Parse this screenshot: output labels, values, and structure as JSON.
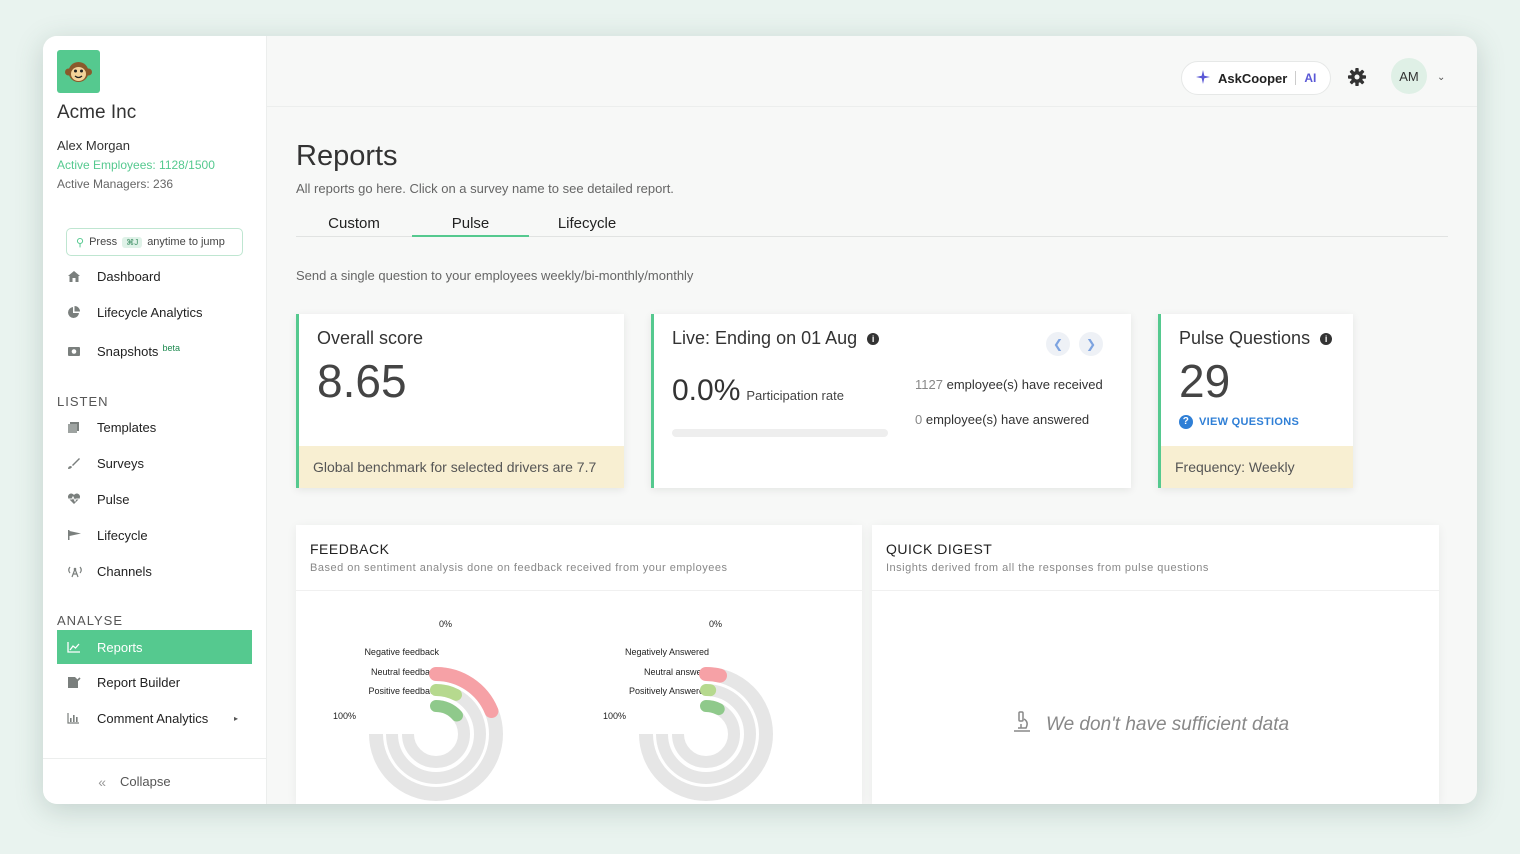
{
  "sidebar": {
    "company": "Acme Inc",
    "user_name": "Alex Morgan",
    "active_employees": "Active Employees: 1128/1500",
    "active_managers": "Active Managers: 236",
    "jump": {
      "press": "Press",
      "shortcut": "⌘J",
      "suffix": "anytime to jump"
    },
    "items_top": [
      {
        "label": "Dashboard",
        "icon": "home-icon"
      },
      {
        "label": "Lifecycle Analytics",
        "icon": "pie-icon"
      },
      {
        "label": "Snapshots",
        "badge": "beta",
        "icon": "camera-icon"
      }
    ],
    "listen_label": "LISTEN",
    "listen_items": [
      {
        "label": "Templates",
        "icon": "templates-icon"
      },
      {
        "label": "Surveys",
        "icon": "brush-icon"
      },
      {
        "label": "Pulse",
        "icon": "heartbeat-icon"
      },
      {
        "label": "Lifecycle",
        "icon": "flag-icon"
      },
      {
        "label": "Channels",
        "icon": "broadcast-icon"
      }
    ],
    "analyse_label": "ANALYSE",
    "analyse_items": [
      {
        "label": "Reports",
        "icon": "chart-icon",
        "active": true
      },
      {
        "label": "Report Builder",
        "icon": "report-builder-icon"
      },
      {
        "label": "Comment Analytics",
        "icon": "bar-chart-icon"
      }
    ],
    "collapse": "Collapse"
  },
  "topbar": {
    "ask": "AskCooper",
    "ai": "AI",
    "avatar": "AM"
  },
  "main": {
    "title": "Reports",
    "subtitle": "All reports go here. Click on a survey name to see detailed report.",
    "tabs": [
      "Custom",
      "Pulse",
      "Lifecycle"
    ],
    "active_tab": "Pulse",
    "pulse_desc": "Send a single question to your employees weekly/bi-monthly/monthly"
  },
  "cards": {
    "overall": {
      "title": "Overall score",
      "value": "8.65",
      "footer": "Global benchmark for selected drivers are 7.7"
    },
    "live": {
      "title": "Live: Ending on 01 Aug",
      "rate": "0.0%",
      "rate_label": "Participation rate",
      "received_count": "1127",
      "received_label": "employee(s) have received",
      "answered_count": "0",
      "answered_label": "employee(s) have answered",
      "progress": 0.0
    },
    "questions": {
      "title": "Pulse Questions",
      "value": "29",
      "link": "VIEW QUESTIONS",
      "footer": "Frequency: Weekly"
    }
  },
  "feedback": {
    "title": "FEEDBACK",
    "subtitle": "Based on sentiment analysis done on feedback received from your employees",
    "donut1": {
      "top_label": "0%",
      "end_label": "100%",
      "rings": [
        {
          "label": "Negative feedback",
          "value": 0.25,
          "color": "#f6a1a6"
        },
        {
          "label": "Neutral feedback",
          "value": 0.1,
          "color": "#b6d98e"
        },
        {
          "label": "Positive feedback",
          "value": 0.18,
          "color": "#8fc98b"
        }
      ]
    },
    "donut2": {
      "top_label": "0%",
      "end_label": "100%",
      "rings": [
        {
          "label": "Negatively Answered",
          "value": 0.05,
          "color": "#f6a1a6"
        },
        {
          "label": "Neutral answers",
          "value": 0.02,
          "color": "#b6d98e"
        },
        {
          "label": "Positively Answered",
          "value": 0.1,
          "color": "#8fc98b"
        }
      ]
    }
  },
  "digest": {
    "title": "QUICK DIGEST",
    "subtitle": "Insights derived from all the responses from pulse questions",
    "empty": "We don't have sufficient data"
  }
}
